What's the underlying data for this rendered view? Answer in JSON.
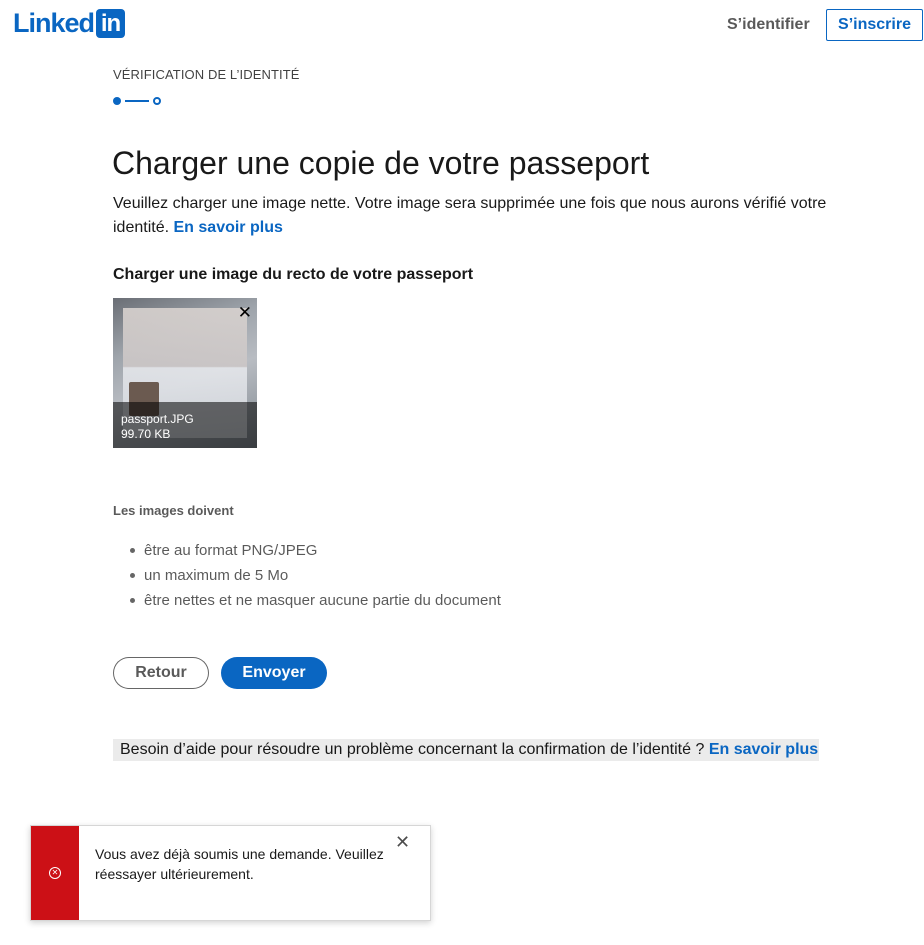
{
  "header": {
    "logo_word": "Linked",
    "logo_box": "in",
    "signin_label": "S’identifier",
    "join_label": "S’inscrire"
  },
  "step": {
    "title": "VÉRIFICATION DE L’IDENTITÉ"
  },
  "main": {
    "title": "Charger une copie de votre passeport",
    "intro": "Veuillez charger une image nette. Votre image sera supprimée une fois que nous aurons vérifié votre identité.",
    "intro_link": "En savoir plus",
    "upload_label": "Charger une image du recto de votre passeport",
    "file": {
      "name": "passport.JPG",
      "size": "99.70 KB"
    },
    "requirements_title": "Les images doivent",
    "requirements": [
      "être au format PNG/JPEG",
      "un maximum de 5 Mo",
      "être nettes et ne masquer aucune partie du document"
    ],
    "back_label": "Retour",
    "send_label": "Envoyer",
    "help_text": "Besoin d’aide pour résoudre un problème concernant la confirmation de l’identité ?",
    "help_link": "En savoir plus"
  },
  "toast": {
    "message": "Vous avez déjà soumis une demande. Veuillez réessayer ultérieurement."
  },
  "colors": {
    "brand": "#0a66c2",
    "error": "#cc1016"
  }
}
